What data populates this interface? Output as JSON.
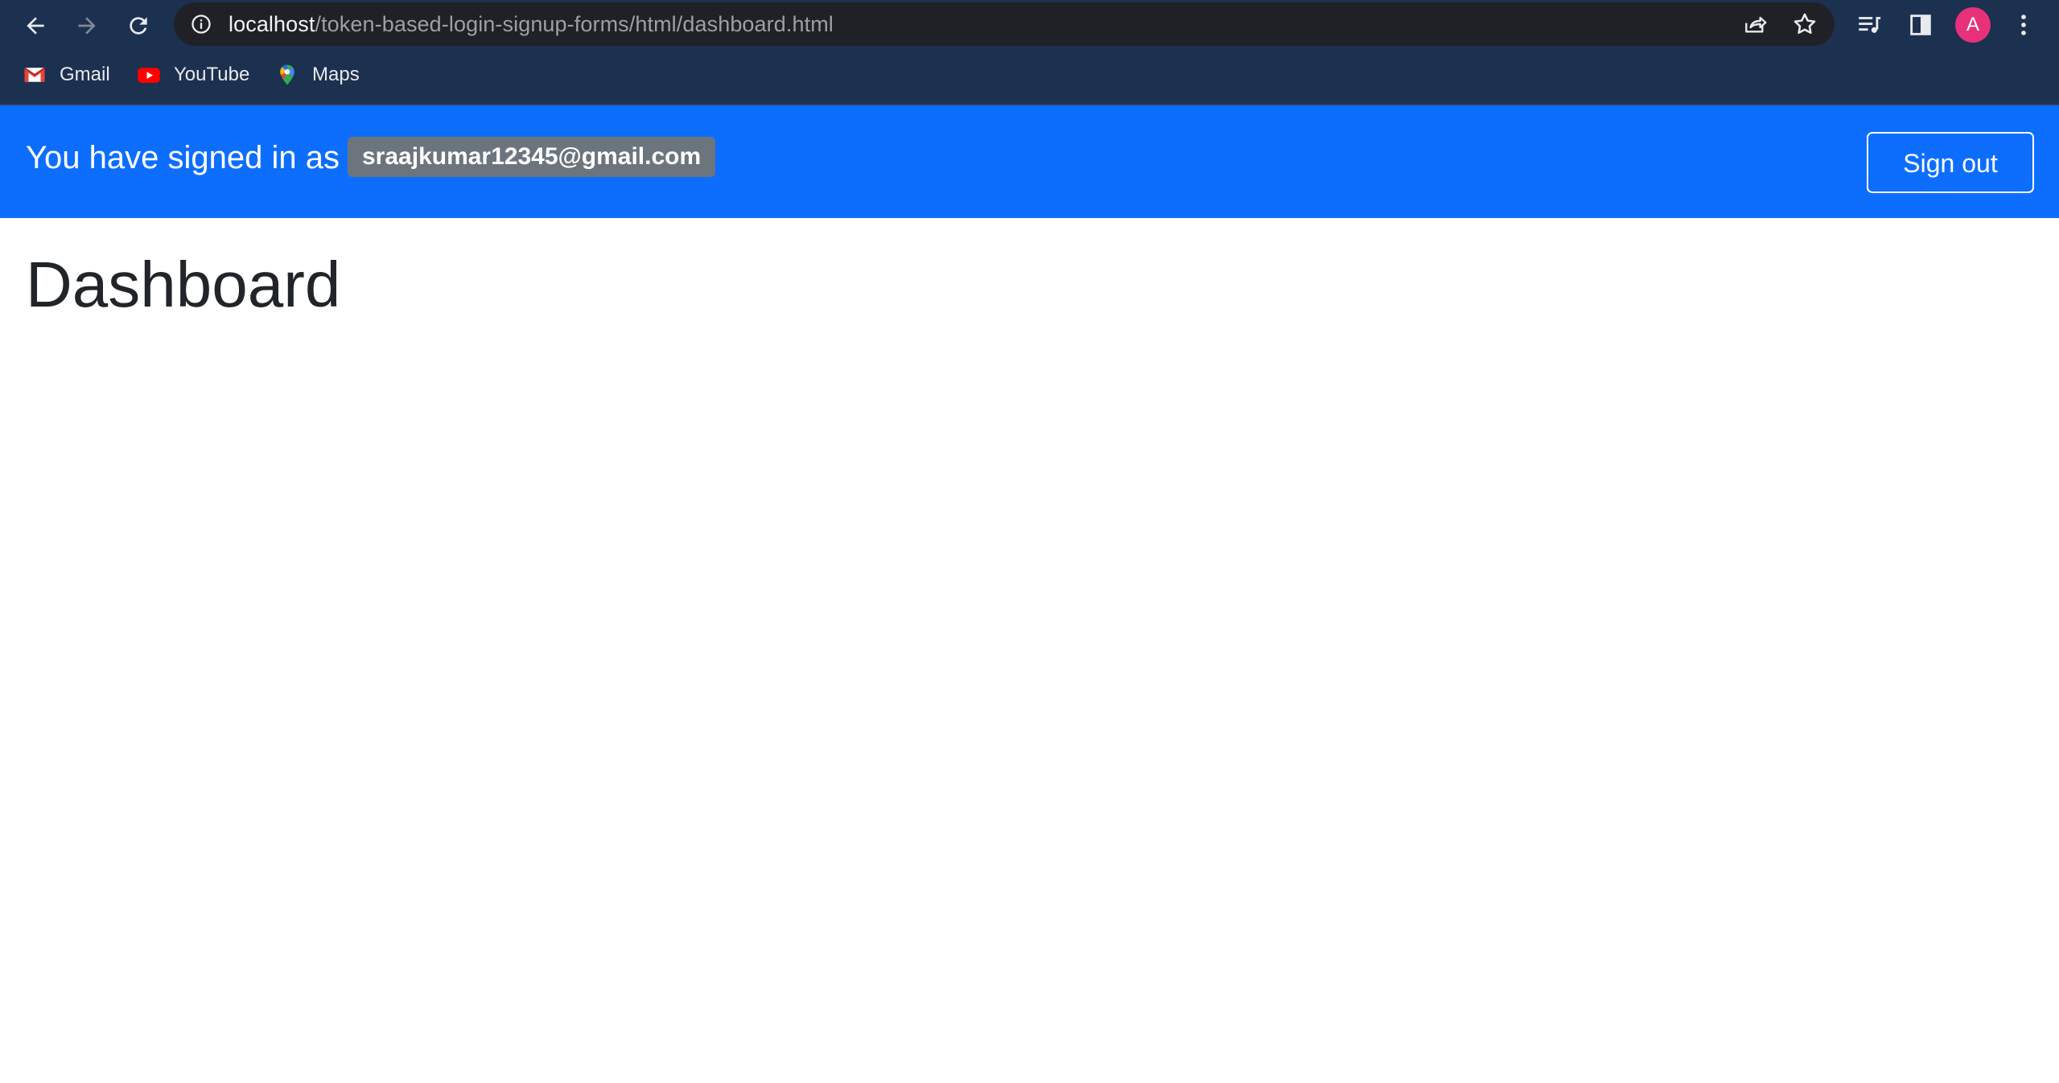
{
  "browser": {
    "url_host": "localhost",
    "url_path": "/token-based-login-signup-forms/html/dashboard.html",
    "profile_initial": "A",
    "icons": {
      "back": "arrow-left-icon",
      "forward": "arrow-right-icon",
      "reload": "reload-icon",
      "info": "info-icon",
      "share": "share-icon",
      "bookmark": "star-icon",
      "media": "media-control-icon",
      "side_panel": "side-panel-icon",
      "menu": "kebab-menu-icon"
    },
    "bookmarks": [
      {
        "label": "Gmail",
        "icon": "gmail-icon"
      },
      {
        "label": "YouTube",
        "icon": "youtube-icon"
      },
      {
        "label": "Maps",
        "icon": "maps-icon"
      }
    ]
  },
  "navbar": {
    "signed_in_text": "You have signed in as",
    "user_email": "sraajkumar12345@gmail.com",
    "sign_out_label": "Sign out"
  },
  "main": {
    "title": "Dashboard"
  },
  "colors": {
    "chrome_bg": "#1c3050",
    "omnibox_bg": "#1f2126",
    "navbar_bg": "#0d6efd",
    "badge_bg": "#6c757d",
    "avatar_bg": "#e7317a",
    "title_text": "#212529"
  }
}
